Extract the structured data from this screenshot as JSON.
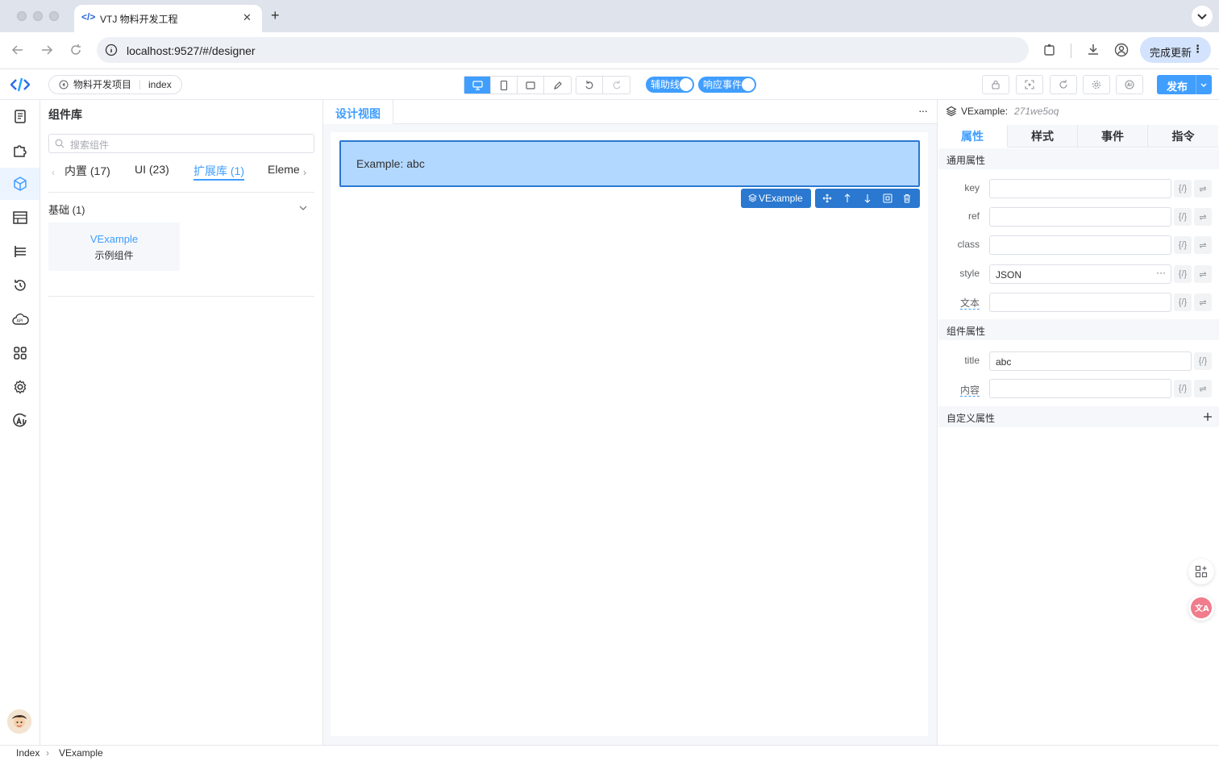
{
  "browser": {
    "tab_title": "VTJ 物料开发工程",
    "url": "localhost:9527/#/designer",
    "update_label": "完成更新"
  },
  "header": {
    "project_name": "物料开发项目",
    "page_name": "index",
    "toggle_guides": "辅助线",
    "toggle_events": "响应事件",
    "publish_label": "发布"
  },
  "library": {
    "title": "组件库",
    "search_placeholder": "搜索组件",
    "tabs": [
      "内置 (17)",
      "UI (23)",
      "扩展库 (1)",
      "Eleme"
    ],
    "active_tab_index": 2,
    "group_title": "基础 (1)",
    "component_name": "VExample",
    "component_desc": "示例组件"
  },
  "canvas": {
    "tab_label": "设计视图",
    "example_text": "Example: abc",
    "selected_badge": "VExample"
  },
  "props": {
    "component_name": "VExample:",
    "component_id": "271we5oq",
    "tabs": [
      "属性",
      "样式",
      "事件",
      "指令"
    ],
    "section_common": "通用属性",
    "section_component": "组件属性",
    "section_custom": "自定义属性",
    "fields": {
      "key": {
        "label": "key",
        "value": ""
      },
      "ref": {
        "label": "ref",
        "value": ""
      },
      "class": {
        "label": "class",
        "value": ""
      },
      "style": {
        "label": "style",
        "value": "JSON"
      },
      "text": {
        "label": "文本",
        "value": ""
      },
      "title": {
        "label": "title",
        "value": "abc"
      },
      "content": {
        "label": "内容",
        "value": ""
      }
    },
    "bind_glyph": "{/}",
    "swap_glyph": "⇌"
  },
  "footer": {
    "crumb_root": "Index",
    "crumb_current": "VExample"
  },
  "colors": {
    "accent": "#409eff",
    "selected_bg": "#b3d8ff",
    "selected_border": "#2a78d0"
  }
}
